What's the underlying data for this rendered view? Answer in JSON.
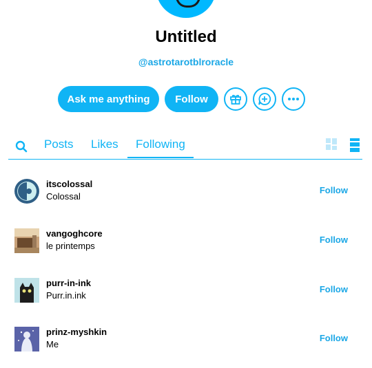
{
  "profile": {
    "title": "Untitled",
    "handle": "@astrotarotblroracle"
  },
  "actions": {
    "ask_label": "Ask me anything",
    "follow_label": "Follow"
  },
  "tabs": {
    "posts": "Posts",
    "likes": "Likes",
    "following": "Following"
  },
  "colors": {
    "accent": "#10b4f5"
  },
  "following_list": [
    {
      "name": "itscolossal",
      "subtitle": "Colossal",
      "action": "Follow"
    },
    {
      "name": "vangoghcore",
      "subtitle": "le printemps",
      "action": "Follow"
    },
    {
      "name": "purr-in-ink",
      "subtitle": "Purr.in.ink",
      "action": "Follow"
    },
    {
      "name": "prinz-myshkin",
      "subtitle": "Me",
      "action": "Follow"
    }
  ]
}
